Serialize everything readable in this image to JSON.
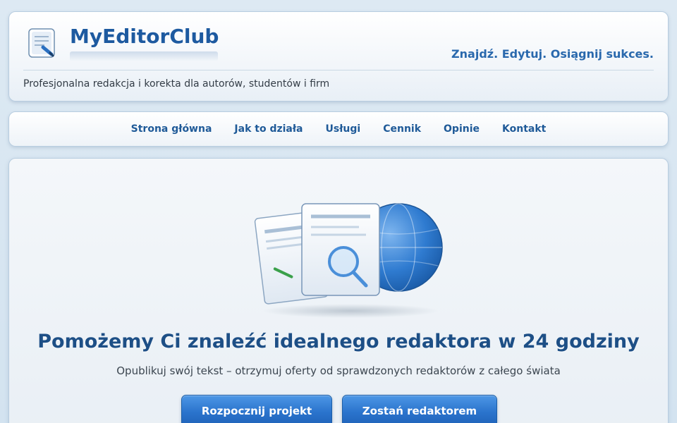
{
  "header": {
    "brand": "MyEditorClub",
    "slogan": "Znajdź. Edytuj. Osiągnij sukces.",
    "subtitle": "Profesjonalna redakcja i korekta dla autorów, studentów i firm",
    "logo_icon": "document-pen-icon"
  },
  "nav": {
    "items": [
      {
        "label": "Strona główna"
      },
      {
        "label": "Jak to działa"
      },
      {
        "label": "Usługi"
      },
      {
        "label": "Cennik"
      },
      {
        "label": "Opinie"
      },
      {
        "label": "Kontakt"
      }
    ]
  },
  "hero": {
    "illustration": "documents-magnifier-globe-icon",
    "title": "Pomożemy Ci znaleźć idealnego redaktora w 24 godziny",
    "subtitle": "Opublikuj swój tekst – otrzymuj oferty od sprawdzonych redaktorów z całego świata",
    "buttons": {
      "start_label": "Rozpocznij projekt",
      "editor_label": "Zostań redaktorem"
    }
  },
  "colors": {
    "accent": "#1d5aa0",
    "button": "#2a73cc",
    "background": "#dde9f3"
  }
}
